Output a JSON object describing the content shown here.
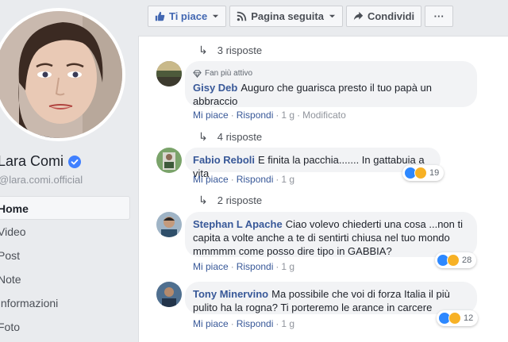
{
  "sidebar": {
    "page_name": "Lara Comi",
    "handle": "@lara.comi.official",
    "nav": [
      {
        "label": "Home",
        "active": true
      },
      {
        "label": "Video",
        "active": false
      },
      {
        "label": "Post",
        "active": false
      },
      {
        "label": "Note",
        "active": false
      },
      {
        "label": "Informazioni",
        "active": false
      },
      {
        "label": "Foto",
        "active": false
      }
    ]
  },
  "actionbar": {
    "like_label": "Ti piace",
    "follow_label": "Pagina seguita",
    "share_label": "Condividi",
    "more_label": "···"
  },
  "colors": {
    "link": "#385898",
    "like_blue": "#2d88ff",
    "haha_yellow": "#f7b125",
    "bubble_bg": "#f2f3f5"
  },
  "threads": [
    {
      "replies_label": "3 risposte"
    },
    {
      "replies_label": "4 risposte"
    },
    {
      "replies_label": "2 risposte"
    }
  ],
  "comments": [
    {
      "badge": "Fan più attivo",
      "author": "Gisy Deb",
      "text_line1": "Auguro che guarisca presto il tuo papà un",
      "text_line2": "abbraccio",
      "like": "Mi piace",
      "reply": "Rispondi",
      "time": "1 g",
      "edited": "Modificato"
    },
    {
      "author": "Fabio Reboli",
      "text_line1": "E finita la pacchia....... In gattabuia a vita",
      "like": "Mi piace",
      "reply": "Rispondi",
      "time": "1 g",
      "reactions_count": "19"
    },
    {
      "author": "Stephan L Apache",
      "text_line1": "Ciao volevo chiederti una cosa ...non ti",
      "text_line2": "capita a volte anche a te di sentirti chiusa nel tuo mondo",
      "text_line3": "mmmmm come posso dire tipo in GABBIA?",
      "like": "Mi piace",
      "reply": "Rispondi",
      "time": "1 g",
      "reactions_count": "28"
    },
    {
      "author": "Tony Minervino",
      "text_line1": "Ma possibile che voi di forza Italia il più",
      "text_line2": "pulito ha la rogna? Ti porteremo le arance in carcere",
      "like": "Mi piace",
      "reply": "Rispondi",
      "time": "1 g",
      "reactions_count": "12"
    }
  ]
}
